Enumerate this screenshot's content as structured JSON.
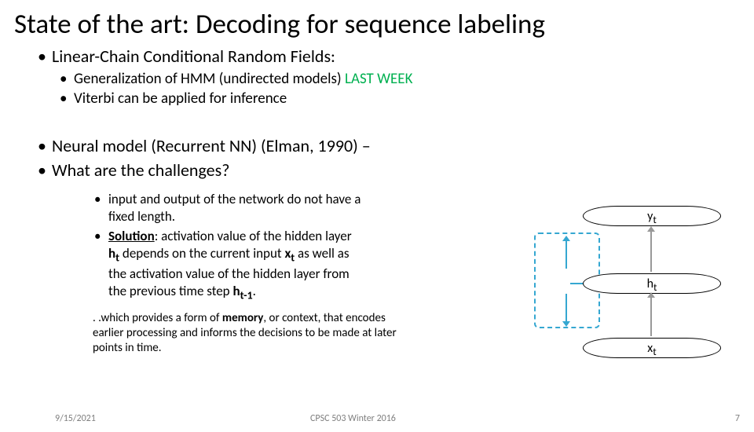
{
  "title": "State of the art: Decoding for sequence labeling",
  "bullets": {
    "crf": "Linear-Chain Conditional Random Fields:",
    "hmm": "Generalization of HMM (undirected models) ",
    "lastweek": "LAST WEEK",
    "viterbi": "Viterbi can be applied for inference",
    "neural": "Neural model (Recurrent NN) (Elman, 1990) –",
    "challenges": "What are the challenges?"
  },
  "sub": {
    "io": "input and output of the network do not have a fixed length.",
    "solution_label": "Solution",
    "solution_pre": ": activation value of the hidden layer ",
    "ht": "h",
    "ht_sub": "t",
    "solution_mid": " depends on the current input ",
    "xt": "x",
    "xt_sub": "t",
    "solution_post": " as well as the activation value of the hidden layer from the previous time step ",
    "htm1": "h",
    "htm1_sub": "t-1",
    "period": "."
  },
  "footnote": {
    "pre": ". .which provides a form of ",
    "mem": "memory",
    "post": ", or context, that encodes earlier processing and informs the decisions to be made at later points in time."
  },
  "diagram": {
    "y": "y",
    "y_sub": "t",
    "h": "h",
    "h_sub": "t",
    "x": "x",
    "x_sub": "t"
  },
  "footer": {
    "date": "9/15/2021",
    "course": "CPSC 503 Winter 2016",
    "page": "7"
  }
}
